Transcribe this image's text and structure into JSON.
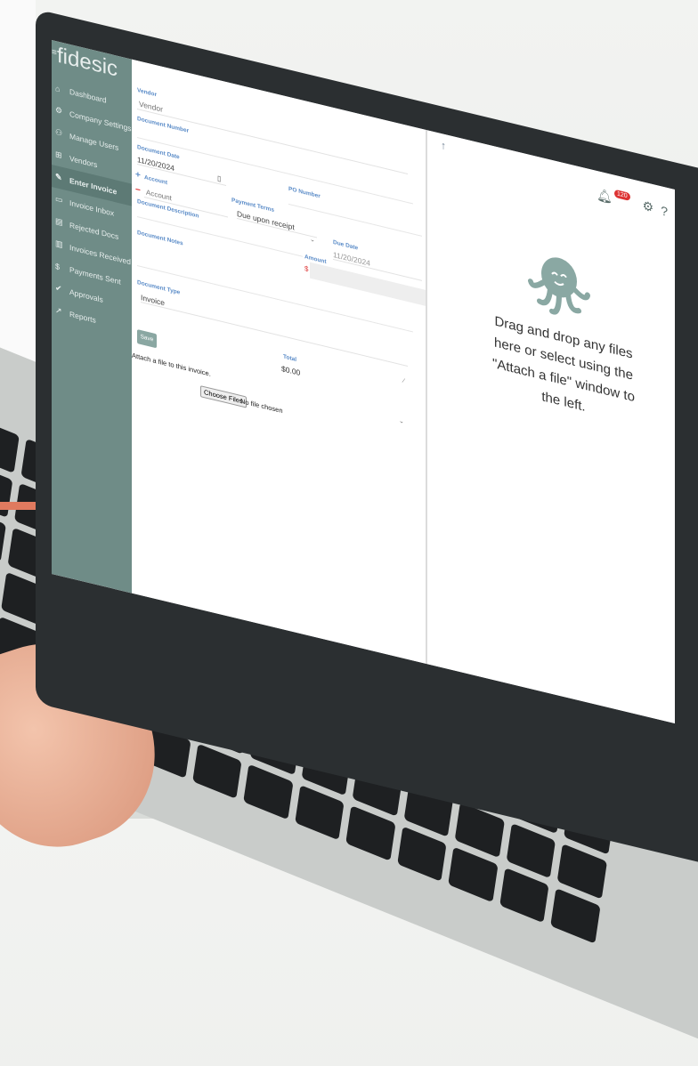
{
  "app": {
    "logo": "fidesic"
  },
  "sidebar": {
    "items": [
      {
        "label": "Dashboard",
        "icon": "dashboard-icon"
      },
      {
        "label": "Company Settings",
        "icon": "gear-icon"
      },
      {
        "label": "Manage Users",
        "icon": "users-icon"
      },
      {
        "label": "Vendors",
        "icon": "cart-icon"
      },
      {
        "label": "Enter Invoice",
        "icon": "invoice-icon"
      },
      {
        "label": "Invoice Inbox",
        "icon": "inbox-icon"
      },
      {
        "label": "Rejected Docs",
        "icon": "document-icon"
      },
      {
        "label": "Invoices Received",
        "icon": "document-icon"
      },
      {
        "label": "Payments Sent",
        "icon": "money-icon"
      },
      {
        "label": "Approvals",
        "icon": "check-icon"
      },
      {
        "label": "Reports",
        "icon": "chart-icon"
      }
    ]
  },
  "form": {
    "vendor_label": "Vendor",
    "vendor_placeholder": "Vendor",
    "doc_number_label": "Document Number",
    "doc_date_label": "Document Date",
    "doc_date_value": "11/20/2024",
    "po_number_label": "PO Number",
    "account_label": "Account",
    "account_placeholder": "Account",
    "payment_terms_label": "Payment Terms",
    "payment_terms_value": "Due upon receipt",
    "due_date_label": "Due Date",
    "due_date_value": "11/20/2024",
    "doc_description_label": "Document Description",
    "amount_label": "Amount",
    "amount_prefix": "$",
    "doc_notes_label": "Document Notes",
    "doc_type_label": "Document Type",
    "doc_type_value": "Invoice",
    "save_label": "Save",
    "attach_label": "Attach a file to this invoice.",
    "choose_files_label": "Choose Files",
    "no_file_text": "No file chosen",
    "total_label": "Total",
    "total_value": "$0.00"
  },
  "upload": {
    "notification_count": "120",
    "drop_text": "Drag and drop any files here or select using the \"Attach a file\" window to the left."
  },
  "colors": {
    "sidebar": "#6f8c87",
    "accent_label": "#5b8cc8",
    "badge": "#d33333",
    "brand_orange": "#e07a5f"
  }
}
